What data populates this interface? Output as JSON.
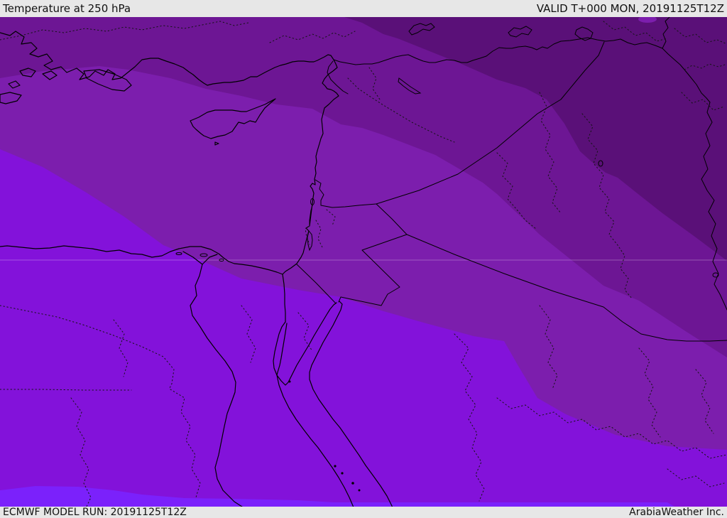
{
  "header": {
    "title": "Temperature at 250 hPa",
    "valid": "VALID T+000 MON, 20191125T12Z"
  },
  "footer": {
    "model_run": "ECMWF MODEL RUN: 20191125T12Z",
    "brand": "ArabiaWeather Inc."
  },
  "map": {
    "product": "Temperature at 250 hPa",
    "model": "ECMWF",
    "region": "Middle East",
    "palette": {
      "band_coldest_ne": "#5a1078",
      "band_very_cold": "#6d1694",
      "band_cold_mid": "#7c1ead",
      "band_milder_sw": "#8312da",
      "band_warmest_strip": "#7b21fb",
      "chrome_bg": "#e7e7e7",
      "line_color": "#000000"
    }
  }
}
